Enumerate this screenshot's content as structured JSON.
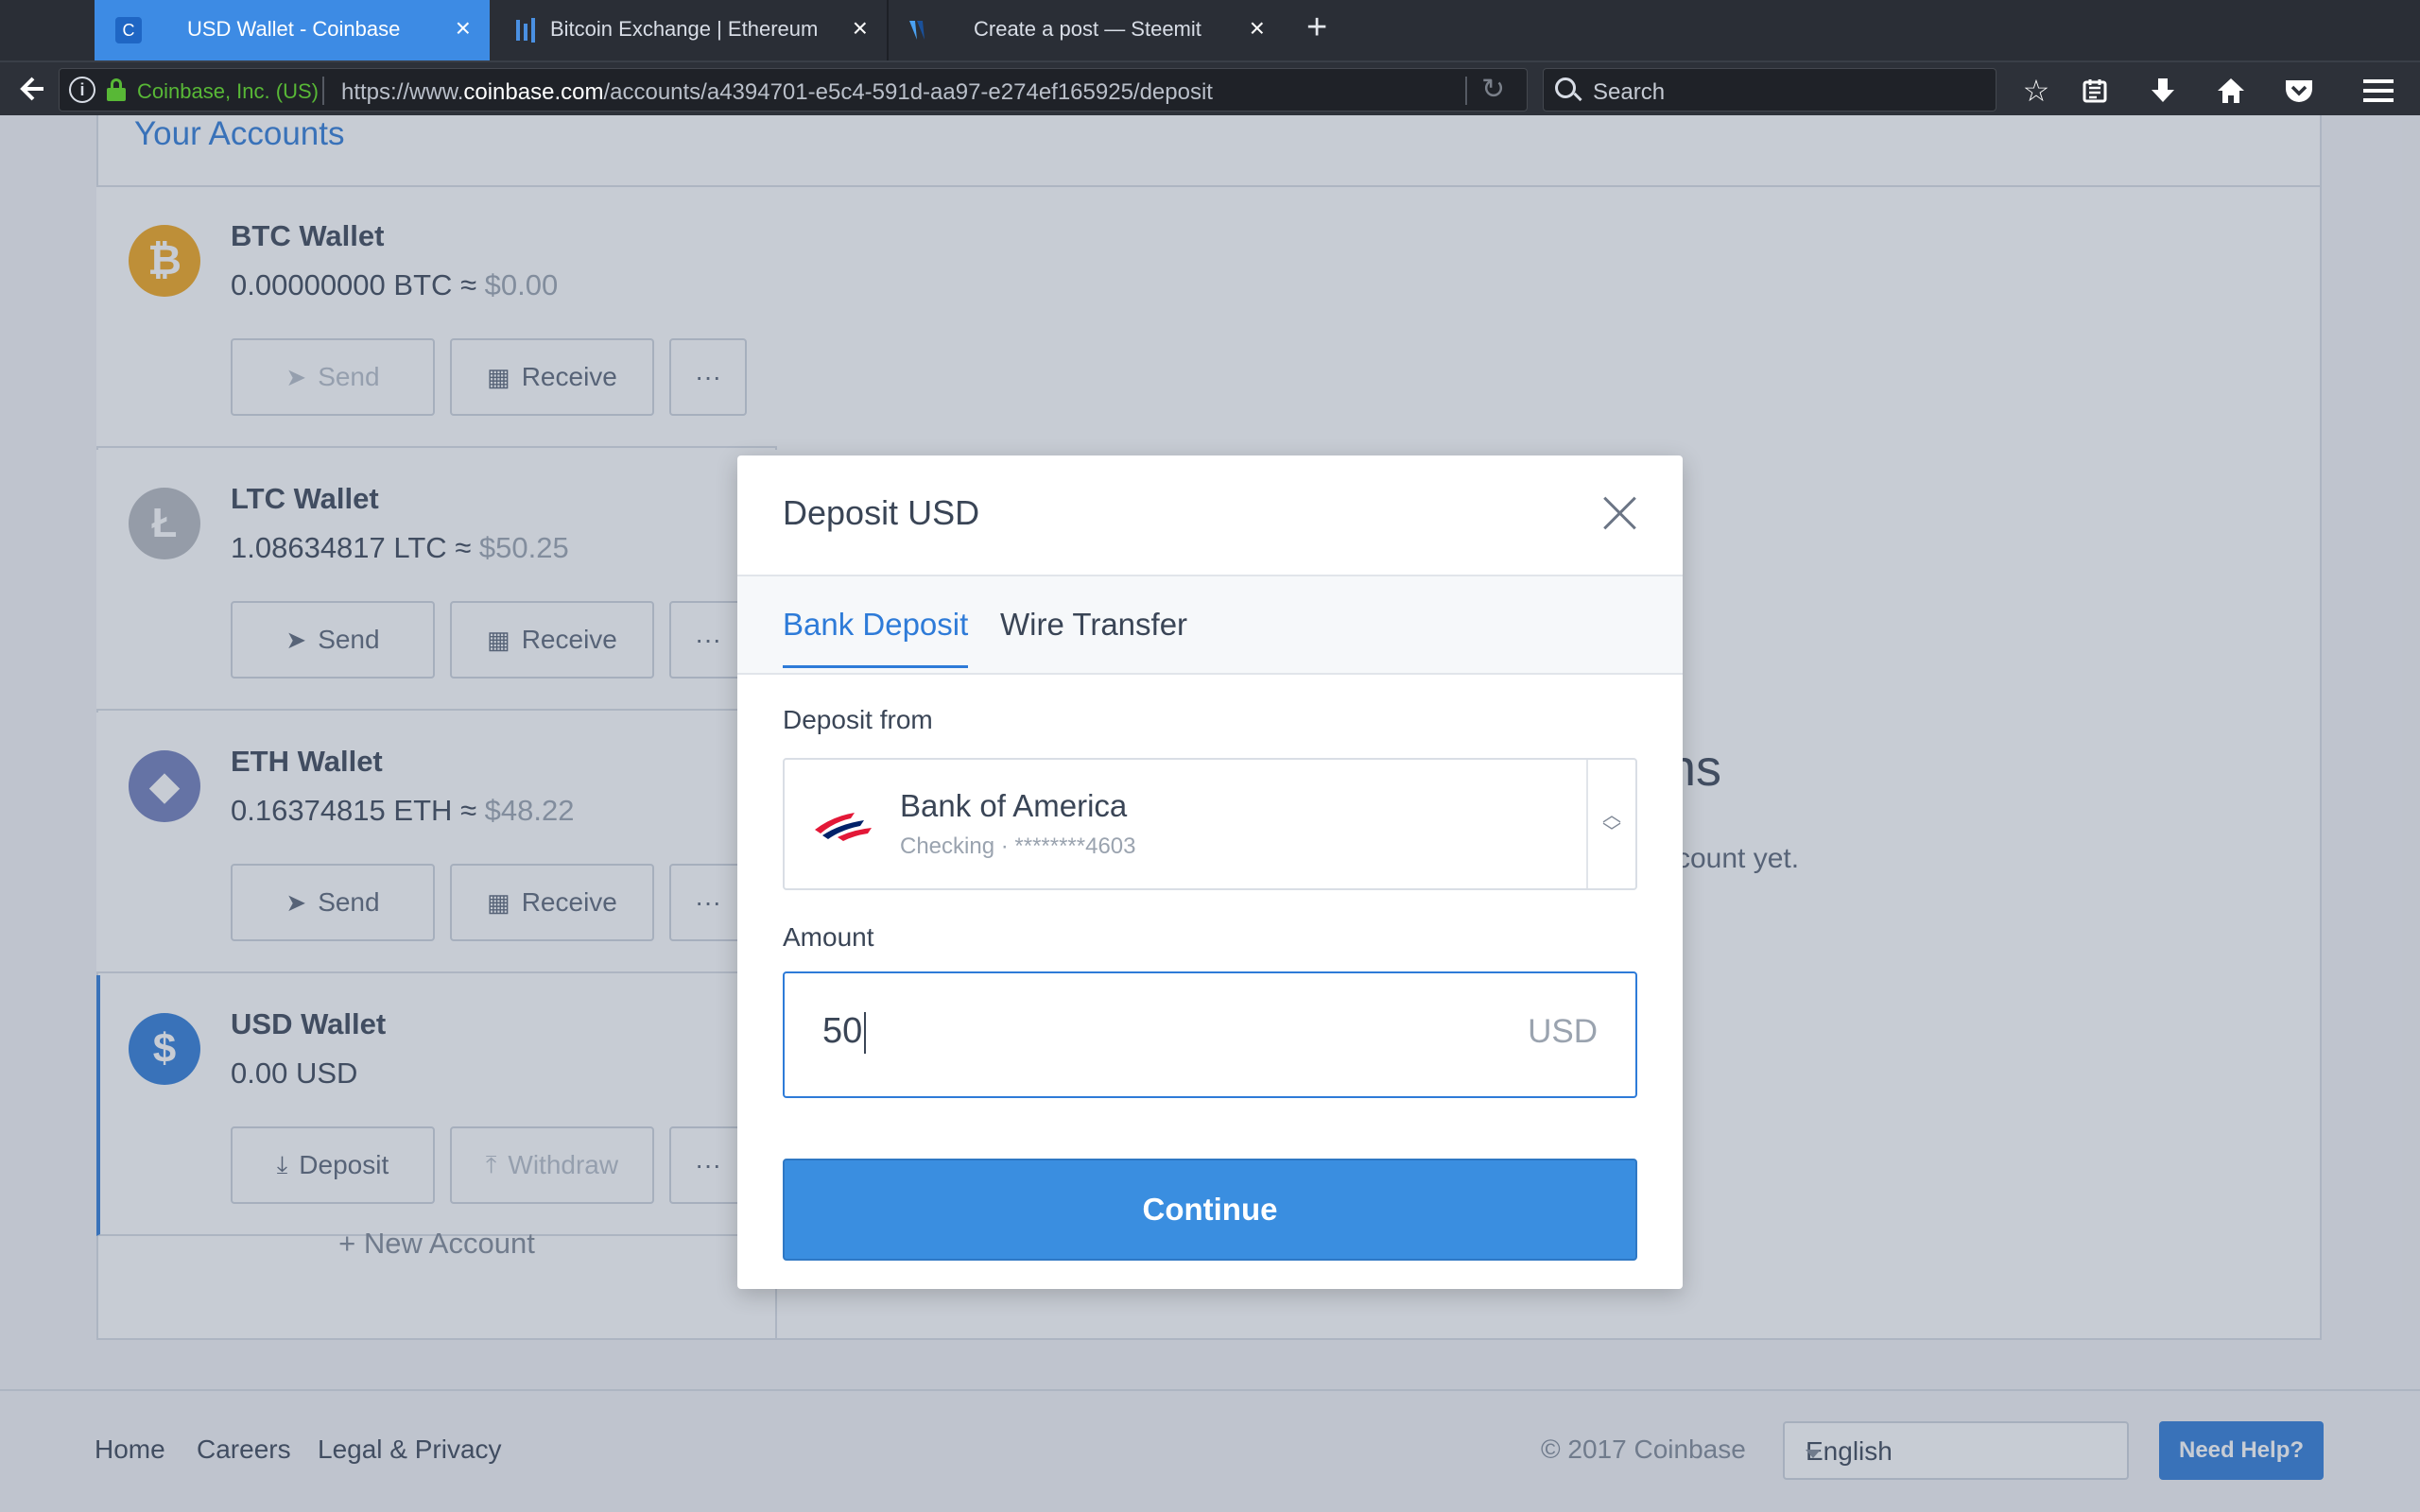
{
  "browser": {
    "tabs": [
      {
        "title": "USD Wallet - Coinbase",
        "favicon": "coinbase-icon",
        "active": true
      },
      {
        "title": "Bitcoin Exchange | Ethereum",
        "favicon": "exchange-icon",
        "active": false
      },
      {
        "title": "Create a post — Steemit",
        "favicon": "steemit-icon",
        "active": false
      }
    ],
    "site_identity": "Coinbase, Inc. (US)",
    "url_prefix": "https://www.",
    "url_domain": "coinbase.com",
    "url_path": "/accounts/a4394701-e5c4-591d-aa97-e274ef165925/deposit",
    "search_placeholder": "Search"
  },
  "page": {
    "section_title": "Your Accounts",
    "accounts": [
      {
        "name": "BTC Wallet",
        "balance": "0.00000000 BTC ≈",
        "fiat": "$0.00",
        "symbol": "₿",
        "color": "#f2a51a",
        "buttons": [
          {
            "label": "Send",
            "icon": "send-icon",
            "disabled": true
          },
          {
            "label": "Receive",
            "icon": "qr-icon",
            "disabled": false
          }
        ]
      },
      {
        "name": "LTC Wallet",
        "balance": "1.08634817 LTC ≈",
        "fiat": "$50.25",
        "symbol": "Ł",
        "color": "#b5b9bf",
        "buttons": [
          {
            "label": "Send",
            "icon": "send-icon",
            "disabled": false
          },
          {
            "label": "Receive",
            "icon": "qr-icon",
            "disabled": false
          }
        ]
      },
      {
        "name": "ETH Wallet",
        "balance": "0.16374815 ETH ≈",
        "fiat": "$48.22",
        "symbol": "◆",
        "color": "#6f7cba",
        "buttons": [
          {
            "label": "Send",
            "icon": "send-icon",
            "disabled": false
          },
          {
            "label": "Receive",
            "icon": "qr-icon",
            "disabled": false
          }
        ]
      },
      {
        "name": "USD Wallet",
        "balance": "0.00 USD",
        "fiat": "",
        "symbol": "$",
        "color": "#2e7bd8",
        "buttons": [
          {
            "label": "Deposit",
            "icon": "download-icon",
            "disabled": false
          },
          {
            "label": "Withdraw",
            "icon": "upload-icon",
            "disabled": true
          }
        ]
      }
    ],
    "more_label": "···",
    "new_account": "+ New Account",
    "right_heading_fragment": "ns",
    "right_sub_fragment": "ccount yet."
  },
  "modal": {
    "title": "Deposit USD",
    "tabs": [
      "Bank Deposit",
      "Wire Transfer"
    ],
    "deposit_from_label": "Deposit from",
    "bank_name": "Bank of America",
    "bank_detail": "Checking · ********4603",
    "amount_label": "Amount",
    "amount_value": "50",
    "amount_unit": "USD",
    "continue_label": "Continue"
  },
  "footer": {
    "links": [
      "Home",
      "Careers",
      "Legal & Privacy"
    ],
    "copyright": "© 2017 Coinbase",
    "language": "English",
    "help": "Need Help?"
  },
  "colors": {
    "accent": "#2e7bd8",
    "continue_button": "#3a8ee0",
    "secure_green": "#58b836"
  }
}
